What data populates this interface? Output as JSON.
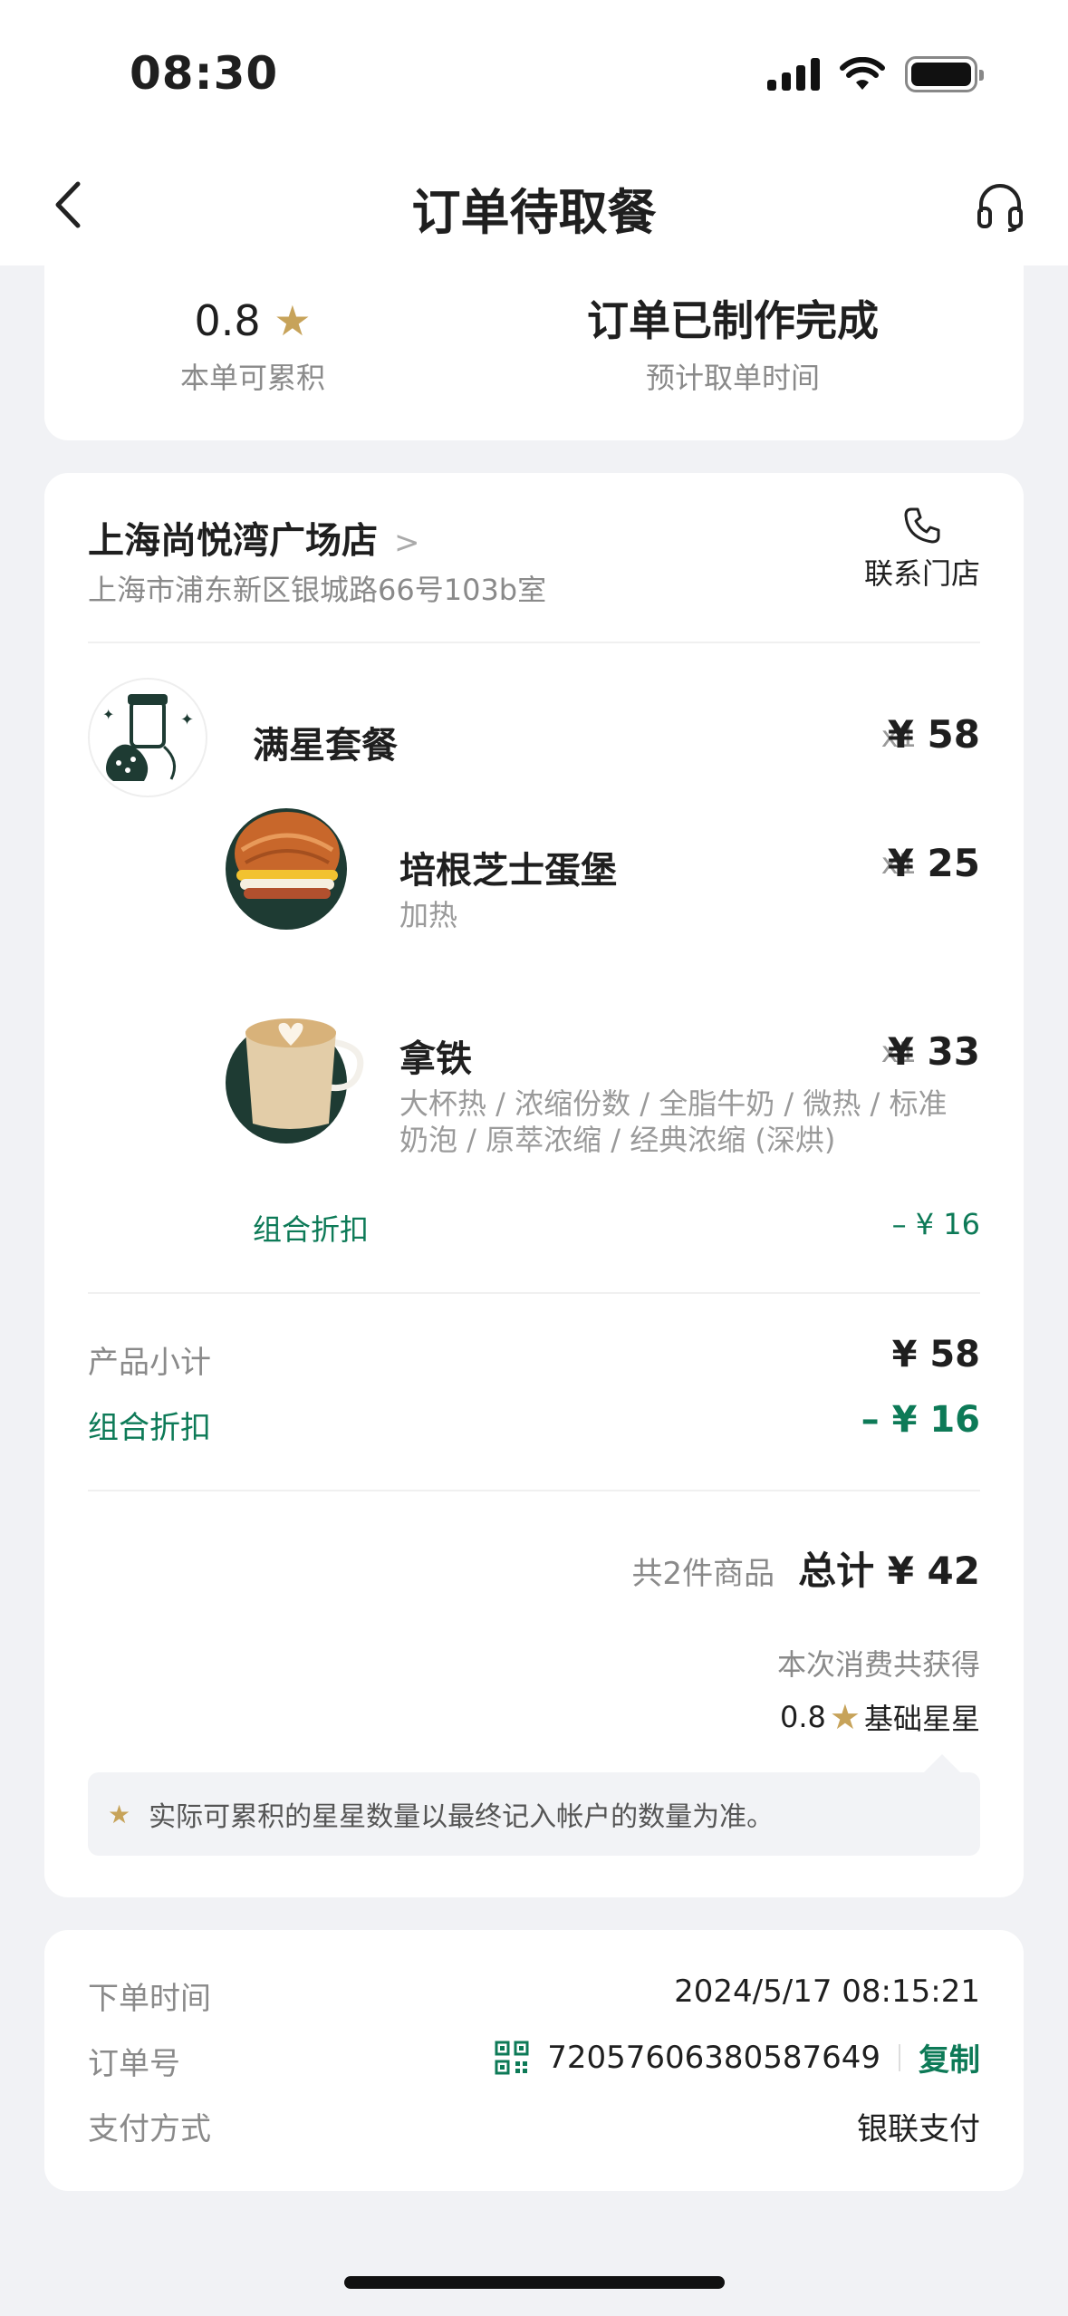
{
  "status_bar": {
    "time": "08:30"
  },
  "nav": {
    "title": "订单待取餐",
    "back_icon": "chevron-left-icon",
    "service_icon": "headset-icon"
  },
  "summary": {
    "stars_value": "0.8",
    "stars_label": "本单可累积",
    "order_status": "订单已制作完成",
    "pickup_label": "预计取单时间"
  },
  "store": {
    "name": "上海尚悦湾广场店",
    "address": "上海市浦东新区银城路66号103b室",
    "contact_label": "联系门店"
  },
  "items": {
    "combo": {
      "name": "满星套餐",
      "qty": "x1",
      "price": "¥ 58"
    },
    "burger": {
      "name": "培根芝士蛋堡",
      "desc": "加热",
      "qty": "x1",
      "price": "¥ 25"
    },
    "latte": {
      "name": "拿铁",
      "desc": "大杯热 / 浓缩份数 / 全脂牛奶 / 微热 / 标准奶泡 / 原萃浓缩 / 经典浓缩 (深烘)",
      "qty": "x1",
      "price": "¥ 33"
    },
    "combo_discount": {
      "label": "组合折扣",
      "value": "– ¥ 16"
    }
  },
  "totals": {
    "subtotal_label": "产品小计",
    "subtotal_value": "¥ 58",
    "discount_label": "组合折扣",
    "discount_value": "– ¥ 16",
    "count_label": "共2件商品",
    "total_label": "总计 ¥ 42",
    "earned_label": "本次消费共获得",
    "earned_value": "0.8",
    "earned_unit": "基础星星",
    "note": "实际可累积的星星数量以最终记入帐户的数量为准。"
  },
  "order_info": {
    "time_label": "下单时间",
    "time_value": "2024/5/17 08:15:21",
    "number_label": "订单号",
    "number_value": "72057606380587649",
    "copy_label": "复制",
    "pay_label": "支付方式",
    "pay_value": "银联支付"
  },
  "colors": {
    "accent": "#0d7a57",
    "star": "#c7a35a",
    "background": "#f1f2f5"
  }
}
